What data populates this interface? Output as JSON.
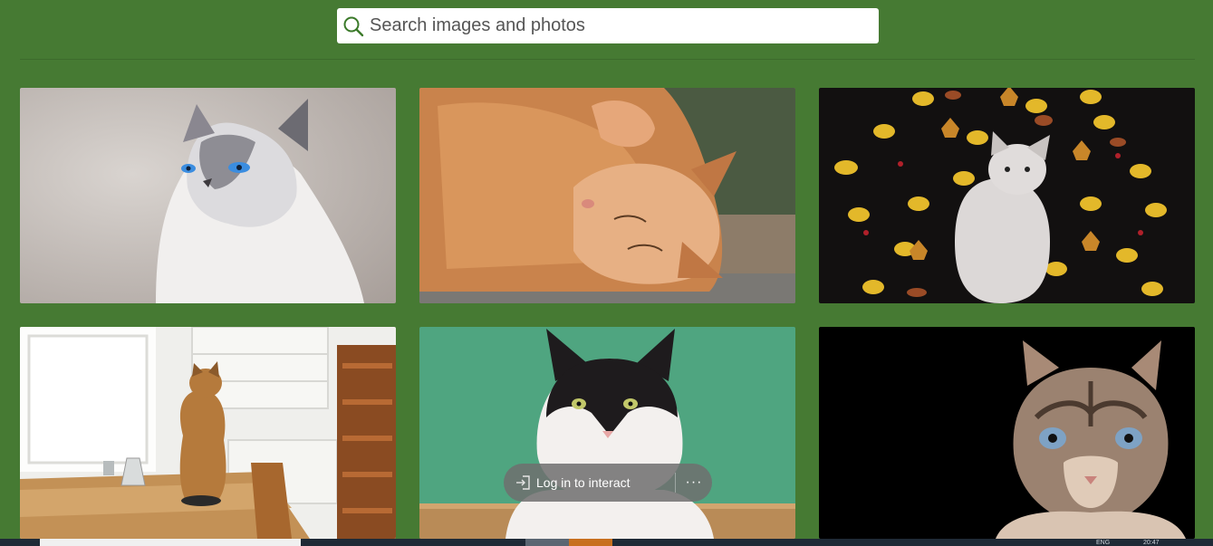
{
  "search": {
    "placeholder": "Search images and photos",
    "value": "",
    "icon": "search-icon"
  },
  "gallery": {
    "images": [
      {
        "subject": "siamese-cat",
        "colors": {
          "bg": "#bdb7b3",
          "main": "#ece9e7",
          "accent": "#6c6b72"
        }
      },
      {
        "subject": "orange-cat-lying",
        "colors": {
          "bg": "#8c7a66",
          "main": "#c9834c",
          "accent": "#e7b084"
        }
      },
      {
        "subject": "kitten-autumn-leaves",
        "colors": {
          "bg": "#0f0e0e",
          "main": "#e0dcdb",
          "accent": "#e3b82a"
        }
      },
      {
        "subject": "tabby-cat-kitchen-table",
        "colors": {
          "bg": "#efefec",
          "main": "#b57a3c",
          "accent": "#d3a56b"
        }
      },
      {
        "subject": "black-white-cat-green-wall",
        "colors": {
          "bg": "#4fa580",
          "main": "#f3f0ee",
          "accent": "#1e1b1d"
        }
      },
      {
        "subject": "tabby-cat-black-background",
        "colors": {
          "bg": "#000000",
          "main": "#9b8270",
          "accent": "#7ea2c4"
        }
      }
    ]
  },
  "overlay": {
    "login_label": "Log in to interact",
    "more_label": "···",
    "login_icon": "login-icon"
  },
  "taskbar": {
    "lang": "ENG",
    "time": "20:47"
  },
  "colors": {
    "page_bg": "#467a33",
    "search_bg": "#ffffff",
    "overlay_bg": "#6e6e6e"
  }
}
